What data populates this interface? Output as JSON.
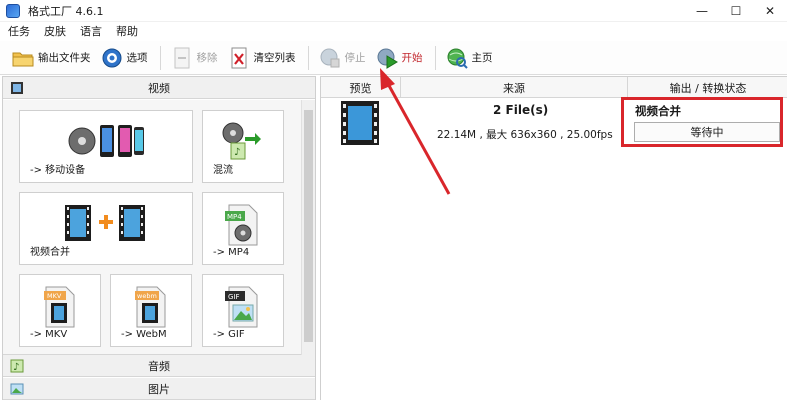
{
  "window": {
    "title": "格式工厂 4.6.1",
    "controls": [
      "—",
      "☐",
      "✕"
    ]
  },
  "menu": [
    "任务",
    "皮肤",
    "语言",
    "帮助"
  ],
  "toolbar": {
    "output_folder": "输出文件夹",
    "options": "选项",
    "remove": "移除",
    "clear_list": "清空列表",
    "stop": "停止",
    "start": "开始",
    "home": "主页"
  },
  "left_panel": {
    "video_header": "视频",
    "tiles": [
      {
        "label": "-> 移动设备",
        "icon": "mobile-device-icon"
      },
      {
        "label": "混流",
        "icon": "mux-icon"
      },
      {
        "label": "视频合并",
        "icon": "video-merge-icon"
      },
      {
        "label": "-> MP4",
        "icon": "mp4-file-icon",
        "badge": "MP4"
      },
      {
        "label": "-> MKV",
        "icon": "mkv-file-icon",
        "badge": "MKV"
      },
      {
        "label": "-> WebM",
        "icon": "webm-file-icon",
        "badge": "webm"
      },
      {
        "label": "-> GIF",
        "icon": "gif-file-icon",
        "badge": "GIF"
      }
    ],
    "audio_header": "音频",
    "image_header": "图片"
  },
  "task_list": {
    "headers": {
      "preview": "预览",
      "source": "来源",
      "output_status": "输出 / 转换状态"
    },
    "task": {
      "files": "2 File(s)",
      "info": "22.14M , 最大 636x360 , 25.00fps",
      "status_title": "视频合并",
      "status": "等待中"
    }
  },
  "colors": {
    "highlight": "#d9262b",
    "start": "#2a9b2a"
  }
}
